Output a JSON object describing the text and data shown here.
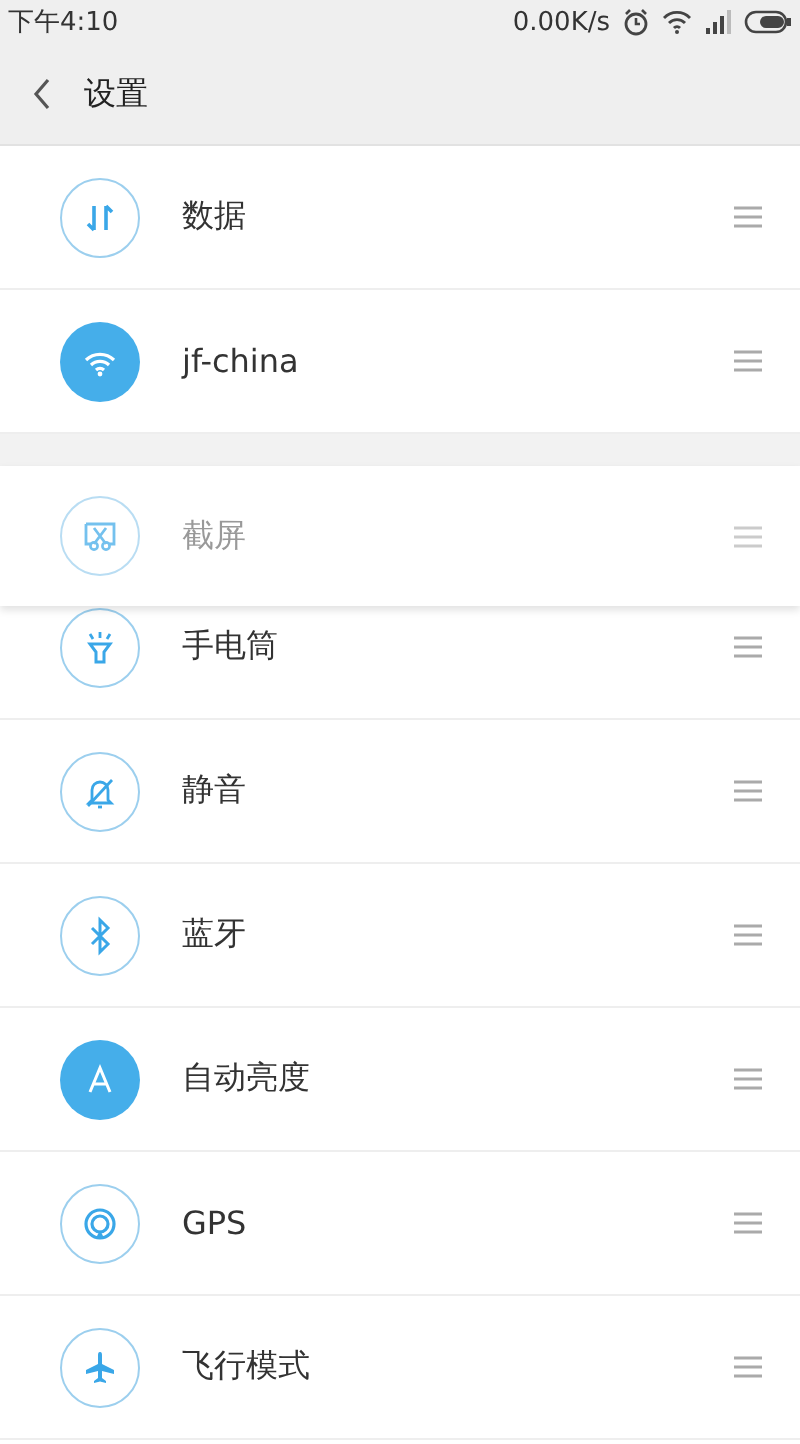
{
  "status_bar": {
    "time": "下午4:10",
    "speed": "0.00K/s"
  },
  "header": {
    "title": "设置"
  },
  "toggles": [
    {
      "label": "数据",
      "on": false,
      "dragging": false
    },
    {
      "label": "jf-china",
      "on": true,
      "dragging": false
    },
    {
      "label": "截屏",
      "on": false,
      "dragging": true
    },
    {
      "label": "手电筒",
      "on": false,
      "dragging": false
    },
    {
      "label": "静音",
      "on": false,
      "dragging": false
    },
    {
      "label": "蓝牙",
      "on": false,
      "dragging": false
    },
    {
      "label": "自动亮度",
      "on": true,
      "dragging": false
    },
    {
      "label": "GPS",
      "on": false,
      "dragging": false
    },
    {
      "label": "飞行模式",
      "on": false,
      "dragging": false
    }
  ]
}
